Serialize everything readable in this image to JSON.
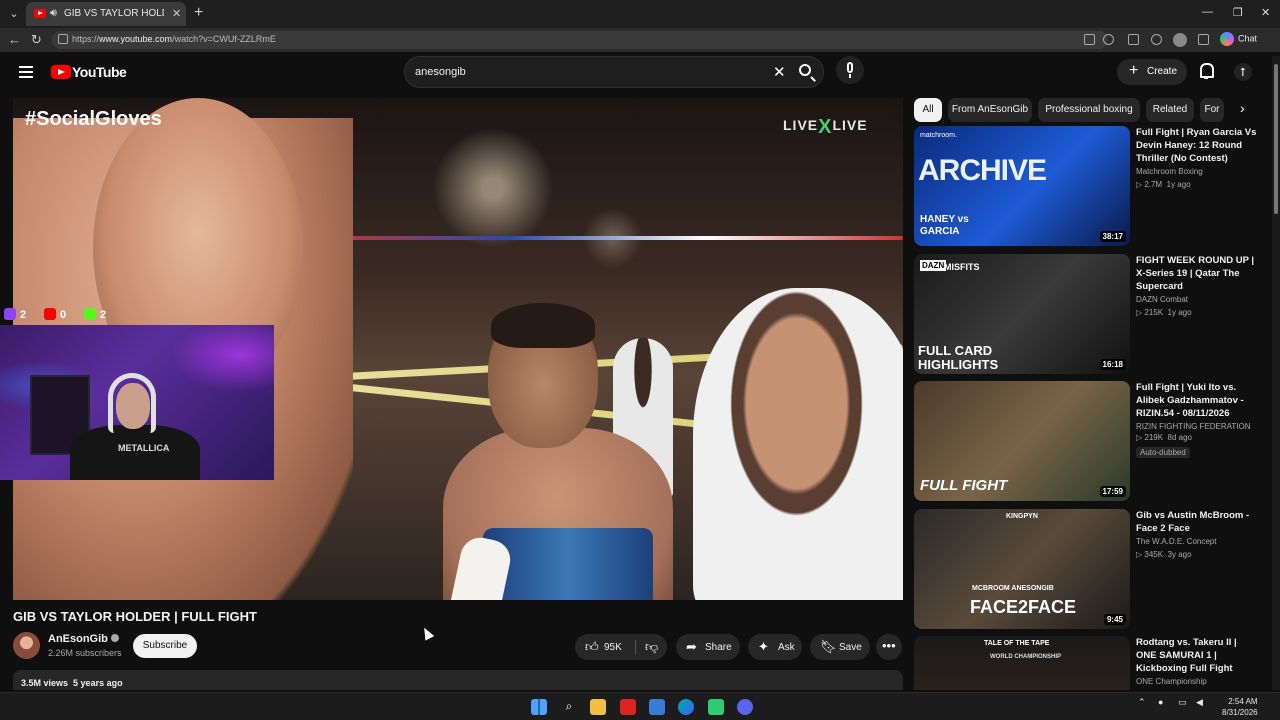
{
  "browser": {
    "tab_title": "GIB VS TAYLOR HOLDER | FUL",
    "url_prefix": "https://",
    "url_host": "www.youtube.com",
    "url_path": "/watch?v=CWUf-ZZLRmE",
    "chat_label": "Chat"
  },
  "header": {
    "logo_text": "YouTube",
    "search_value": "anesongib",
    "create_label": "Create"
  },
  "player": {
    "watermark": "#SocialGloves",
    "live_logo_left": "LIVE",
    "live_logo_x": "X",
    "live_logo_right": "LIVE",
    "stats": [
      "2",
      "0",
      "2"
    ],
    "webcam_shirt": "METALLICA"
  },
  "video": {
    "title": "GIB VS TAYLOR HOLDER | FULL FIGHT",
    "channel": "AnEsonGib",
    "subscribers": "2.26M subscribers",
    "subscribe_label": "Subscribe",
    "likes": "95K",
    "share_label": "Share",
    "ask_label": "Ask",
    "save_label": "Save",
    "views": "3.5M views",
    "age": "5 years ago"
  },
  "chips": [
    "All",
    "From AnEsonGib",
    "Professional boxing",
    "Related",
    "For"
  ],
  "recommendations": [
    {
      "title": "Full Fight | Ryan Garcia Vs Devin Haney: 12 Round Thriller (No Contest)",
      "channel": "Matchroom Boxing",
      "views": "2.7M",
      "age": "1y ago",
      "duration": "38:17",
      "thumb_big": "ARCHIVE",
      "thumb_small": "HANEY vs GARCIA",
      "thumb_brand": "matchroom."
    },
    {
      "title": "FIGHT WEEK ROUND UP | X-Series 19 | Qatar The Supercard",
      "channel": "DAZN Combat",
      "views": "215K",
      "age": "1y ago",
      "duration": "16:18",
      "thumb_big": "FULL CARD HIGHLIGHTS",
      "thumb_small": "DAZN",
      "thumb_brand": "MISFITS"
    },
    {
      "title": "Full Fight | Yuki Ito vs. Alibek Gadzhammatov - RIZIN.54 - 08/11/2026",
      "channel": "RIZIN FIGHTING FEDERATION",
      "views": "219K",
      "age": "8d ago",
      "badge": "Auto-dubbed",
      "duration": "17:59",
      "thumb_big": "FULL FIGHT"
    },
    {
      "title": "Gib vs Austin McBroom - Face 2 Face",
      "channel": "The W.A.D.E. Concept",
      "views": "345K",
      "age": "3y ago",
      "duration": "9:45",
      "thumb_big": "FACE2FACE",
      "thumb_small": "MCBROOM  ANESONGIB",
      "thumb_brand": "KINGPYN"
    },
    {
      "title": "Rodtang vs. Takeru II | ONE SAMURAI 1 | Kickboxing Full Fight",
      "channel": "ONE Championship",
      "thumb_big": "TALE OF THE TAPE",
      "thumb_small": "WORLD CHAMPIONSHIP"
    }
  ],
  "taskbar": {
    "time": "2:54 AM",
    "date": "8/31/2026"
  },
  "colors": {
    "background": "#0f0f0f",
    "brand_red": "#ff0000",
    "pill": "#272727",
    "text": "#f1f1f1",
    "secondary": "#aaaaaa"
  }
}
